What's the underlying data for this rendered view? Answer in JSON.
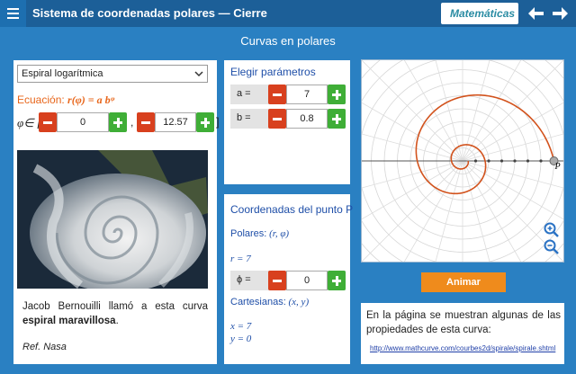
{
  "header": {
    "title": "Sistema de coordenadas polares  —  Cierre",
    "subject": "Matemáticas"
  },
  "page_heading": "Curvas en polares",
  "curve_panel": {
    "selected_curve": "Espiral logarítmica",
    "equation_label": "Ecuación:",
    "equation": "r(φ) = a bᵠ",
    "phi_label": "φ∈ [",
    "phi_close": "]",
    "phi_min": "0",
    "phi_max": "12.57",
    "caption_prefix": "Jacob Bernouilli llamó a esta curva ",
    "caption_bold": "espiral maravillosa",
    "caption_suffix": ".",
    "reference": "Ref. Nasa"
  },
  "params_panel": {
    "title": "Elegir parámetros",
    "a_label": "a =",
    "a_value": "7",
    "b_label": "b =",
    "b_value": "0.8"
  },
  "coords_panel": {
    "title": "Coordenadas del punto P",
    "polar_label": "Polares:",
    "polar_vars": "(r, φ)",
    "r_line": "r = 7",
    "phi_label": "ϕ =",
    "phi_value": "0",
    "cartesian_label": "Cartesianas:",
    "cartesian_vars": "(x, y)",
    "x_line": "x = 7",
    "y_line": "y = 0"
  },
  "graph": {
    "point_label": "P",
    "curve_color": "#d2521c",
    "a": 7,
    "b": 0.8,
    "phi_range": [
      0,
      12.57
    ]
  },
  "animate_label": "Animar",
  "info_panel": {
    "text": "En la página se muestran algunas de las propiedades de esta curva:",
    "link": "http://www.mathcurve.com/courbes2d/spirale/spirale.shtml"
  }
}
